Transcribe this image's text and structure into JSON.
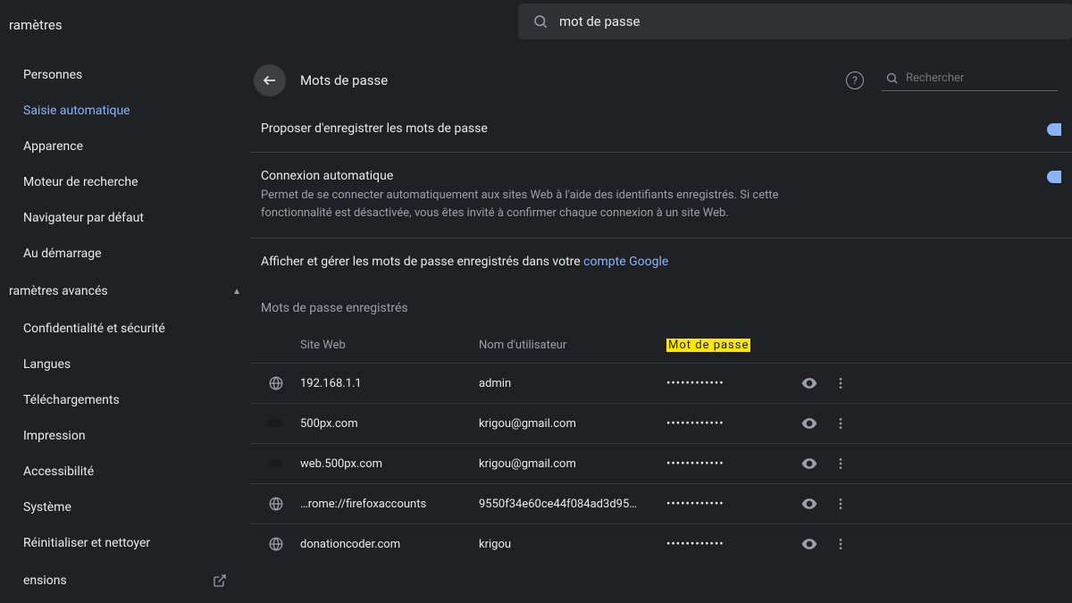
{
  "app_title": "ramètres",
  "top_search_value": "mot de passe",
  "sidebar": {
    "items": [
      {
        "label": "Personnes",
        "active": false
      },
      {
        "label": "Saisie automatique",
        "active": true
      },
      {
        "label": "Apparence",
        "active": false
      },
      {
        "label": "Moteur de recherche",
        "active": false
      },
      {
        "label": "Navigateur par défaut",
        "active": false
      },
      {
        "label": "Au démarrage",
        "active": false
      }
    ],
    "advanced_header": "ramètres avancés",
    "advanced_items": [
      {
        "label": "Confidentialité et sécurité"
      },
      {
        "label": "Langues"
      },
      {
        "label": "Téléchargements"
      },
      {
        "label": "Impression"
      },
      {
        "label": "Accessibilité"
      },
      {
        "label": "Système"
      },
      {
        "label": "Réinitialiser et nettoyer"
      }
    ],
    "extensions_label": "ensions"
  },
  "page": {
    "title": "Mots de passe",
    "search_placeholder": "Rechercher",
    "offer_save": {
      "title": "Proposer d'enregistrer les mots de passe"
    },
    "auto_signin": {
      "title": "Connexion automatique",
      "desc": "Permet de se connecter automatiquement aux sites Web à l'aide des identifiants enregistrés. Si cette fonctionnalité est désactivée, vous êtes invité à confirmer chaque connexion à un site Web."
    },
    "google_link_prefix": "Afficher et gérer les mots de passe enregistrés dans votre ",
    "google_link_text": "compte Google",
    "saved_header": "Mots de passe enregistrés",
    "columns": {
      "site": "Site Web",
      "user": "Nom d'utilisateur",
      "pass": "Mot de passe"
    },
    "rows": [
      {
        "icon": "globe",
        "site": "192.168.1.1",
        "user": "admin",
        "pass": "••••••••••••"
      },
      {
        "icon": "dark",
        "site": "500px.com",
        "user": "krigou@gmail.com",
        "pass": "••••••••••••"
      },
      {
        "icon": "dark",
        "site": "web.500px.com",
        "user": "krigou@gmail.com",
        "pass": "••••••••••••"
      },
      {
        "icon": "globe",
        "site": "…rome://firefoxaccounts",
        "user": "9550f34e60ce44f084ad3d95…",
        "pass": "••••••••••••"
      },
      {
        "icon": "globe",
        "site": "donationcoder.com",
        "user": "krigou",
        "pass": "••••••••••••"
      }
    ]
  }
}
